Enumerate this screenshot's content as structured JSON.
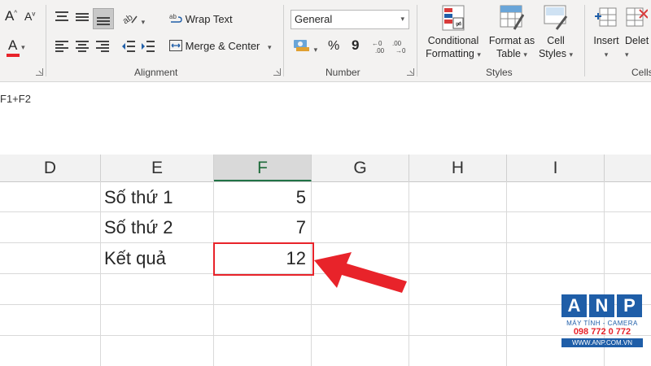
{
  "ribbon": {
    "alignment": {
      "wrap_text": "Wrap Text",
      "merge_center": "Merge & Center",
      "group_label": "Alignment"
    },
    "number": {
      "format_value": "General",
      "group_label": "Number",
      "percent_symbol": "%",
      "comma_symbol": "9"
    },
    "styles": {
      "conditional_formatting": [
        "Conditional",
        "Formatting"
      ],
      "format_as_table": [
        "Format as",
        "Table"
      ],
      "cell_styles": [
        "Cell",
        "Styles"
      ],
      "group_label": "Styles"
    },
    "cells": {
      "insert": "Insert",
      "delete": "Delet",
      "group_label": "Cells"
    },
    "font": {
      "font_color_letter": "A",
      "grow_letter": "A",
      "shrink_letter": "A"
    }
  },
  "formula_bar": {
    "text": "F1+F2"
  },
  "grid": {
    "columns": [
      "D",
      "E",
      "F",
      "G",
      "H",
      "I"
    ],
    "selected_column": "F",
    "rows": [
      {
        "label": "Số thứ 1",
        "value": "5"
      },
      {
        "label": "Số thứ 2",
        "value": "7"
      },
      {
        "label": "Kết quả",
        "value": "12"
      }
    ]
  },
  "watermark": {
    "letters": [
      "A",
      "N",
      "P"
    ],
    "line1": "MÁY TÍNH - CAMERA",
    "phone": "098 772 0 772",
    "url": "WWW.ANP.COM.VN"
  },
  "colors": {
    "excel_green": "#217346",
    "highlight_red": "#e8232a",
    "logo_blue": "#1f5ea8"
  }
}
